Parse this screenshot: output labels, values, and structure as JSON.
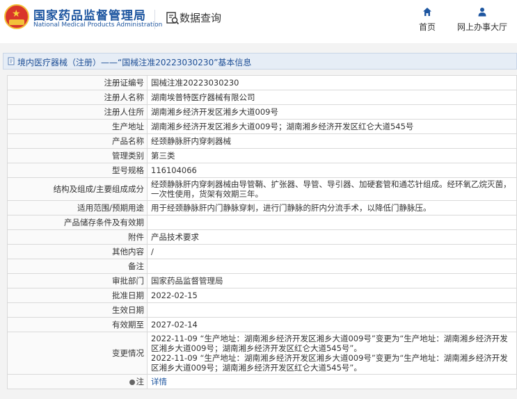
{
  "header": {
    "brand_cn": "国家药品监督管理局",
    "brand_en": "National Medical Products Administration",
    "query_label": "数据查询",
    "nav": {
      "home": "首页",
      "office": "网上办事大厅"
    }
  },
  "breadcrumb": {
    "text": "境内医疗器械（注册）——“国械注准20223030230”基本信息"
  },
  "rows": [
    {
      "label": "注册证编号",
      "value": "国械注准20223030230"
    },
    {
      "label": "注册人名称",
      "value": "湖南埃普特医疗器械有限公司"
    },
    {
      "label": "注册人住所",
      "value": "湖南湘乡经济开发区湘乡大道009号"
    },
    {
      "label": "生产地址",
      "value": "湖南湘乡经济开发区湘乡大道009号；湖南湘乡经济开发区红仑大道545号"
    },
    {
      "label": "产品名称",
      "value": "经颈静脉肝内穿刺器械"
    },
    {
      "label": "管理类别",
      "value": "第三类"
    },
    {
      "label": "型号规格",
      "value": "116104066"
    },
    {
      "label": "结构及组成/主要组成成分",
      "value": "经颈静脉肝内穿刺器械由导管鞘、扩张器、导管、导引器、加硬套管和通芯针组成。经环氧乙烷灭菌，一次性使用，货架有效期三年。"
    },
    {
      "label": "适用范围/预期用途",
      "value": "用于经颈静脉肝内门静脉穿刺，进行门静脉的肝内分流手术，以降低门静脉压。"
    },
    {
      "label": "产品储存条件及有效期",
      "value": ""
    },
    {
      "label": "附件",
      "value": "产品技术要求"
    },
    {
      "label": "其他内容",
      "value": "/"
    },
    {
      "label": "备注",
      "value": ""
    },
    {
      "label": "审批部门",
      "value": "国家药品监督管理局"
    },
    {
      "label": "批准日期",
      "value": "2022-02-15"
    },
    {
      "label": "生效日期",
      "value": ""
    },
    {
      "label": "有效期至",
      "value": "2027-02-14"
    }
  ],
  "change": {
    "label": "变更情况",
    "line1": "2022-11-09 “生产地址：湖南湘乡经济开发区湘乡大道009号”变更为“生产地址：湖南湘乡经济开发区湘乡大道009号；湖南湘乡经济开发区红仑大道545号”。",
    "line2": "2022-11-09 “生产地址：湖南湘乡经济开发区湘乡大道009号”变更为“生产地址：湖南湘乡经济开发区湘乡大道009号；湖南湘乡经济开发区红仑大道545号”。"
  },
  "note": {
    "label": "注",
    "link": "详情"
  }
}
